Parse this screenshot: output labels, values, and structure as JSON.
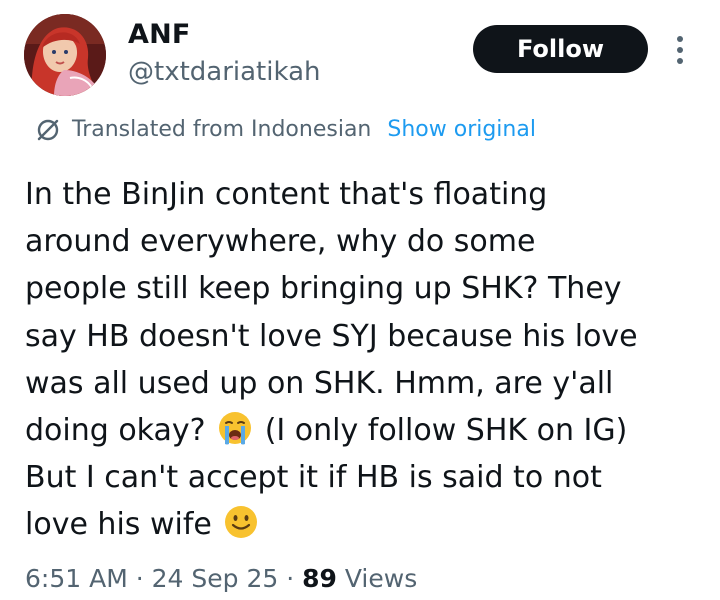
{
  "author": {
    "display_name": "ANF",
    "handle": "@txtdariatikah"
  },
  "header": {
    "follow_label": "Follow"
  },
  "translation": {
    "label": "Translated from Indonesian",
    "show_original_label": "Show original"
  },
  "tweet": {
    "lines": [
      "In the BinJin content that's floating",
      "around everywhere, why do some",
      "people still keep bringing up SHK? They",
      "say HB doesn't love SYJ because his love",
      "was all used up on SHK. Hmm, are y'all",
      "doing okay?",
      "(I only follow SHK on IG)",
      "But I can't accept it if HB is said to not",
      "love his wife"
    ],
    "emojis": [
      "loudly-crying-face-emoji",
      "slightly-smiling-face-emoji"
    ]
  },
  "meta": {
    "time": "6:51 AM",
    "separator": "·",
    "date": "24 Sep 25",
    "views_count": "89",
    "views_label": "Views"
  },
  "colors": {
    "text": "#0f1419",
    "secondary": "#536471",
    "link": "#1d9bf0",
    "button_bg": "#0f1419",
    "emoji_face": "#f8c22f"
  }
}
